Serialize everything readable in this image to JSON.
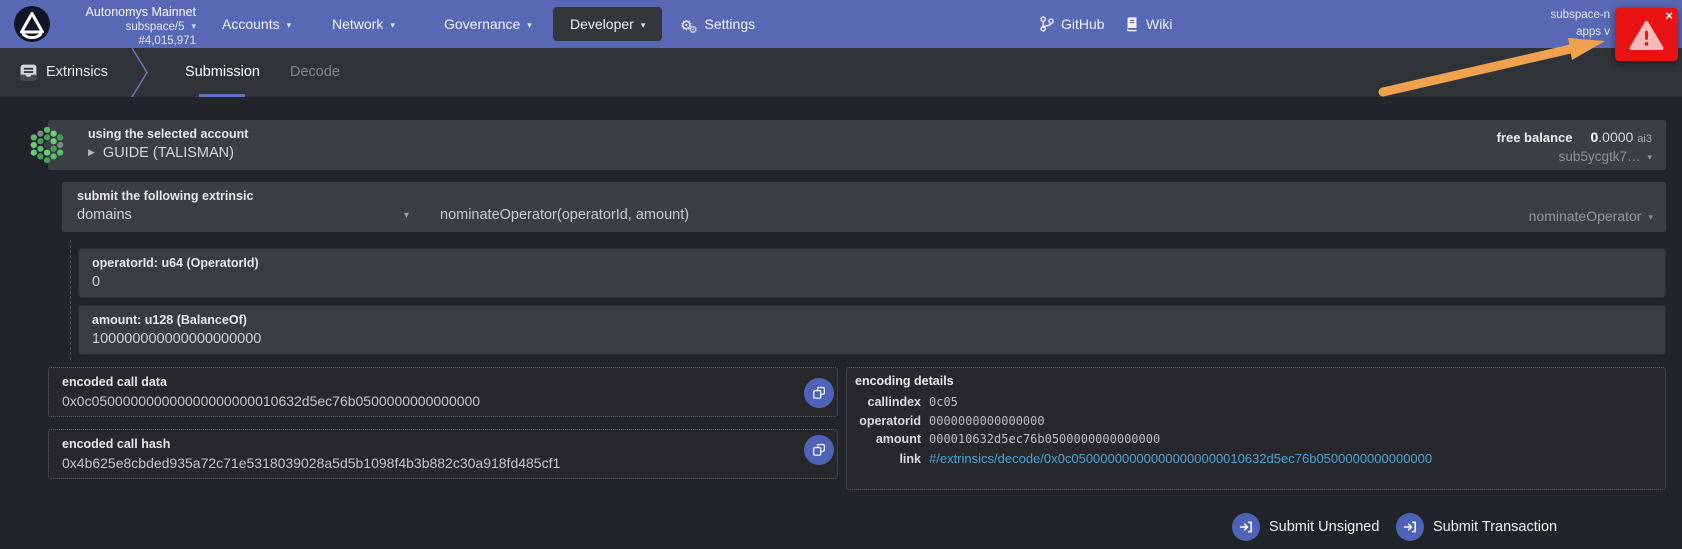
{
  "icons": {
    "caret": "▾",
    "play": "▶",
    "close": "×",
    "gear_big": "⚙",
    "gear_small": "⚙"
  },
  "colors": {
    "bg": "#212428",
    "nav": "#5868b4",
    "tabbar": "#2f3338",
    "panel": "#3b3f44",
    "panel2": "#393d42",
    "accent": "#4e63b6",
    "link": "#4aa3d8",
    "alert": "#e81212",
    "arrow": "#f0a14e"
  },
  "brand": {
    "chain": "Autonomys Mainnet",
    "runtime": "subspace/5",
    "block": "#4,015,971"
  },
  "nav": {
    "items": [
      {
        "label": "Accounts"
      },
      {
        "label": "Network"
      },
      {
        "label": "Governance"
      },
      {
        "label": "Developer"
      },
      {
        "label": "Settings"
      }
    ],
    "github": "GitHub",
    "wiki": "Wiki",
    "node_line1": "subspace-n",
    "node_line2": "apps v"
  },
  "tabbar": {
    "section": "Extrinsics",
    "tabs": [
      {
        "label": "Submission"
      },
      {
        "label": "Decode"
      }
    ]
  },
  "account": {
    "label": "using the selected account",
    "name": "GUIDE (TALISMAN)",
    "balance_label": "free balance",
    "balance_int": "0",
    "balance_frac": ".0000",
    "balance_unit": "ai3",
    "address": "sub5ycgtk7…"
  },
  "extrinsic": {
    "label": "submit the following extrinsic",
    "section": "domains",
    "signature": "nominateOperator(operatorId, amount)",
    "method": "nominateOperator"
  },
  "params": [
    {
      "label": "operatorId: u64 (OperatorId)",
      "value": "0"
    },
    {
      "label": "amount: u128 (BalanceOf)",
      "value": "100000000000000000000"
    }
  ],
  "encoded": {
    "call_data_label": "encoded call data",
    "call_data": "0x0c050000000000000000000010632d5ec76b0500000000000000",
    "call_hash_label": "encoded call hash",
    "call_hash": "0x4b625e8cbded935a72c71e5318039028a5d5b1098f4b3b882c30a918fd485cf1"
  },
  "encoding_details": {
    "title": "encoding details",
    "rows": [
      {
        "label": "callindex",
        "value": "0c05"
      },
      {
        "label": "operatorid",
        "value": "0000000000000000"
      },
      {
        "label": "amount",
        "value": "000010632d5ec76b0500000000000000"
      },
      {
        "label": "link",
        "value": "#/extrinsics/decode/0x0c050000000000000000000010632d5ec76b0500000000000000"
      }
    ]
  },
  "actions": {
    "unsigned": "Submit Unsigned",
    "transaction": "Submit Transaction"
  }
}
